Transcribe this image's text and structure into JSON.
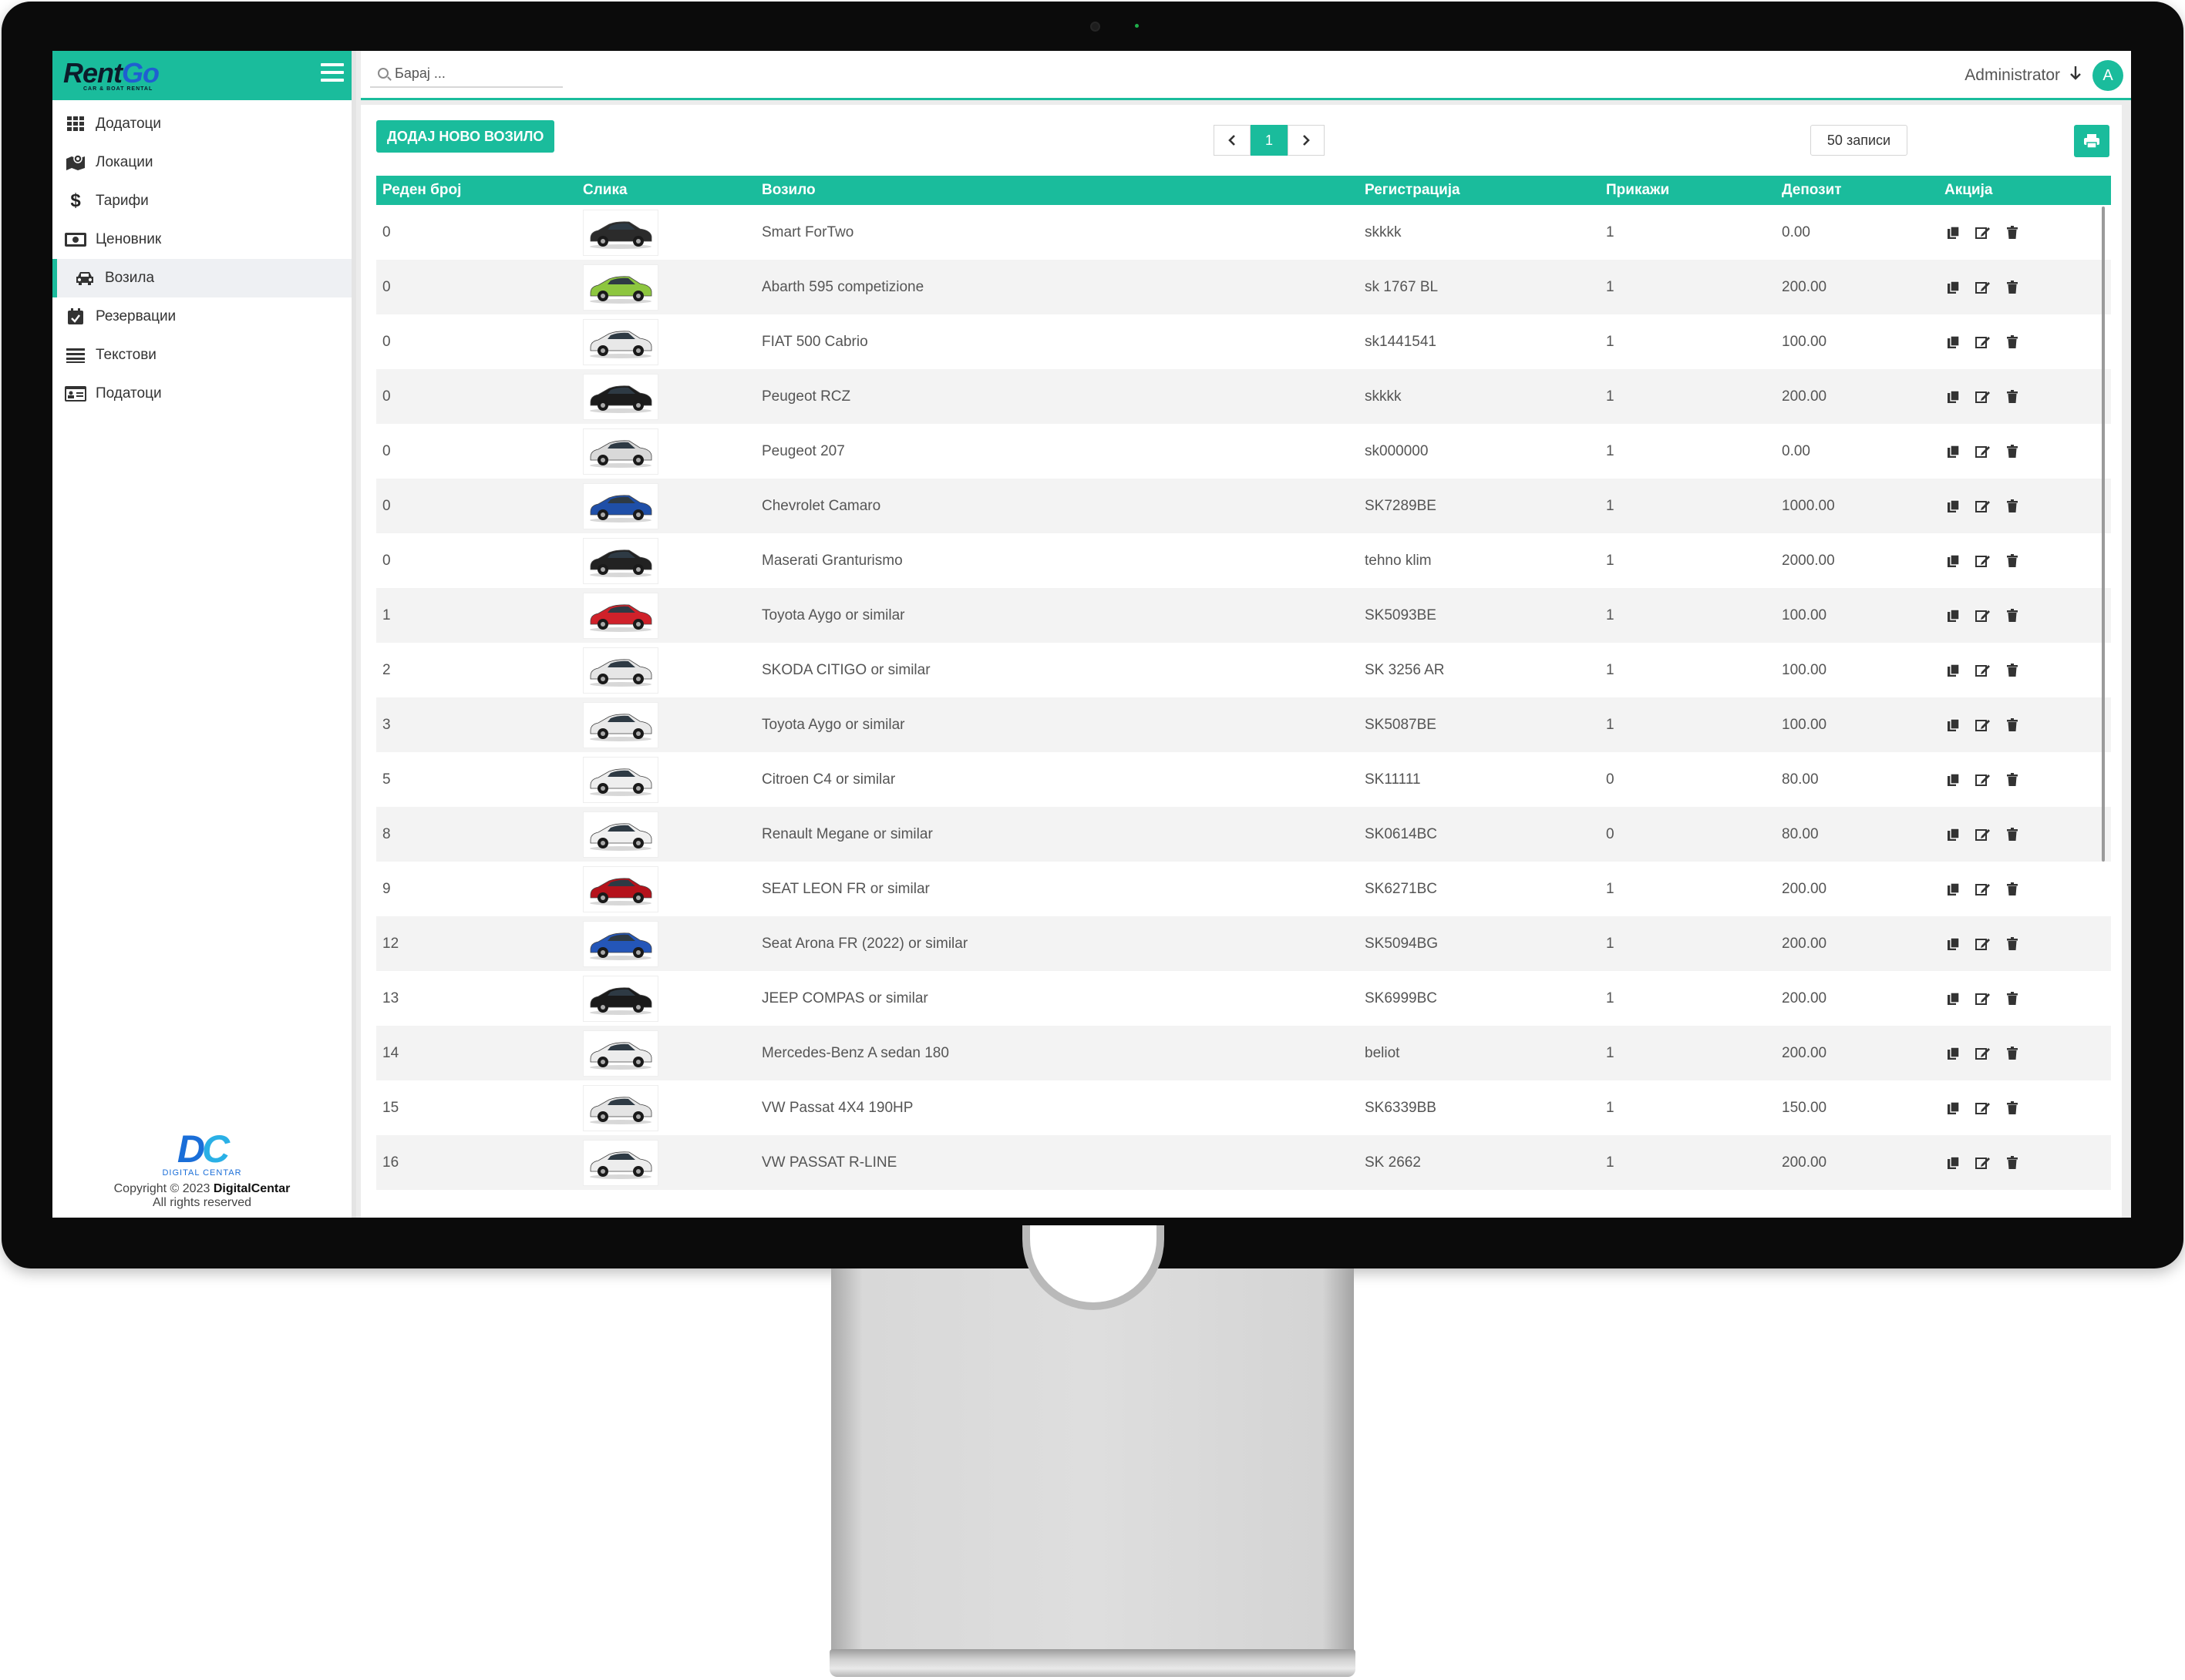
{
  "brand": {
    "name_part1": "Rent",
    "name_part2": "Go",
    "tagline": "CAR & BOAT RENTAL"
  },
  "sidebar": {
    "items": [
      {
        "label": "Додатоци",
        "icon": "grid-icon"
      },
      {
        "label": "Локации",
        "icon": "map-icon"
      },
      {
        "label": "Тарифи",
        "icon": "dollar-icon"
      },
      {
        "label": "Ценовник",
        "icon": "money-icon"
      },
      {
        "label": "Возила",
        "icon": "car-icon",
        "active": true
      },
      {
        "label": "Резервации",
        "icon": "calendar-check-icon"
      },
      {
        "label": "Текстови",
        "icon": "list-icon"
      },
      {
        "label": "Податоци",
        "icon": "id-card-icon"
      }
    ],
    "footer": {
      "logo_text": "DC",
      "logo_sub": "DIGITAL CENTAR",
      "copyright": "Copyright © 2023",
      "company": "DigitalCentar",
      "rights": "All rights reserved"
    }
  },
  "topbar": {
    "search_placeholder": "Барај ...",
    "user_name": "Administrator",
    "avatar_letter": "A"
  },
  "toolbar": {
    "add_label": "ДОДАЈ НОВО ВОЗИЛО",
    "page_current": "1",
    "records_label": "50 записи"
  },
  "colors": {
    "accent": "#1abc9c"
  },
  "table": {
    "headers": [
      "Реден број",
      "Слика",
      "Возило",
      "Регистрација",
      "Прикажи",
      "Депозит",
      "Акција"
    ],
    "rows": [
      {
        "order": "0",
        "vehicle": "Smart ForTwo",
        "registration": "skkkk",
        "show": "1",
        "deposit": "0.00",
        "car_color": "#2b2b2b"
      },
      {
        "order": "0",
        "vehicle": "Abarth 595 competizione",
        "registration": "sk 1767 BL",
        "show": "1",
        "deposit": "200.00",
        "car_color": "#8dc63f"
      },
      {
        "order": "0",
        "vehicle": "FIAT 500 Cabrio",
        "registration": "sk1441541",
        "show": "1",
        "deposit": "100.00",
        "car_color": "#e8e8e8"
      },
      {
        "order": "0",
        "vehicle": "Peugeot RCZ",
        "registration": "skkkk",
        "show": "1",
        "deposit": "200.00",
        "car_color": "#1c1c1c"
      },
      {
        "order": "0",
        "vehicle": "Peugeot 207",
        "registration": "sk000000",
        "show": "1",
        "deposit": "0.00",
        "car_color": "#d9d9d9"
      },
      {
        "order": "0",
        "vehicle": "Chevrolet Camaro",
        "registration": "SK7289BE",
        "show": "1",
        "deposit": "1000.00",
        "car_color": "#1f4fa8"
      },
      {
        "order": "0",
        "vehicle": "Maserati Granturismo",
        "registration": "tehno klim",
        "show": "1",
        "deposit": "2000.00",
        "car_color": "#222222"
      },
      {
        "order": "1",
        "vehicle": "Toyota Aygo or similar",
        "registration": "SK5093BE",
        "show": "1",
        "deposit": "100.00",
        "car_color": "#d0212a"
      },
      {
        "order": "2",
        "vehicle": "SKODA CITIGO or similar",
        "registration": "SK 3256 AR",
        "show": "1",
        "deposit": "100.00",
        "car_color": "#e6e6e6"
      },
      {
        "order": "3",
        "vehicle": "Toyota Aygo or similar",
        "registration": "SK5087BE",
        "show": "1",
        "deposit": "100.00",
        "car_color": "#e9e9e9"
      },
      {
        "order": "5",
        "vehicle": "Citroen C4 or similar",
        "registration": "SK11111",
        "show": "0",
        "deposit": "80.00",
        "car_color": "#eeeeee"
      },
      {
        "order": "8",
        "vehicle": "Renault Megane or similar",
        "registration": "SK0614BC",
        "show": "0",
        "deposit": "80.00",
        "car_color": "#f0f0f0"
      },
      {
        "order": "9",
        "vehicle": "SEAT LEON FR or similar",
        "registration": "SK6271BC",
        "show": "1",
        "deposit": "200.00",
        "car_color": "#b5121b"
      },
      {
        "order": "12",
        "vehicle": "Seat Arona FR (2022) or similar",
        "registration": "SK5094BG",
        "show": "1",
        "deposit": "200.00",
        "car_color": "#2456b8"
      },
      {
        "order": "13",
        "vehicle": "JEEP COMPAS or similar",
        "registration": "SK6999BC",
        "show": "1",
        "deposit": "200.00",
        "car_color": "#1a1a1a"
      },
      {
        "order": "14",
        "vehicle": "Mercedes-Benz A sedan 180",
        "registration": "beliot",
        "show": "1",
        "deposit": "200.00",
        "car_color": "#ececec"
      },
      {
        "order": "15",
        "vehicle": "VW Passat 4X4 190HP",
        "registration": "SK6339BB",
        "show": "1",
        "deposit": "150.00",
        "car_color": "#e4e4e4"
      },
      {
        "order": "16",
        "vehicle": "VW PASSAT R-LINE",
        "registration": "SK 2662",
        "show": "1",
        "deposit": "200.00",
        "car_color": "#ededed"
      }
    ]
  }
}
